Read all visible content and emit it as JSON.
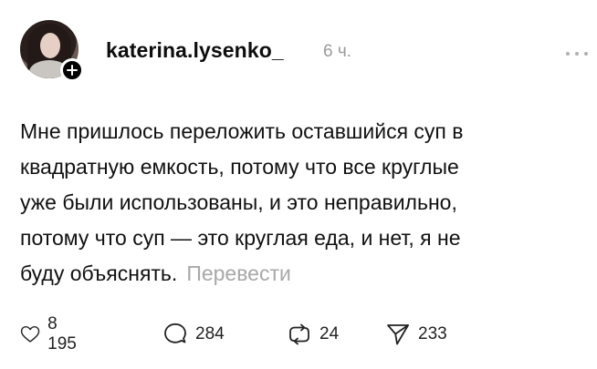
{
  "post": {
    "username": "katerina.lysenko_",
    "time": "6 ч.",
    "text_lines": [
      "Мне пришлось переложить оставшийся суп в",
      "квадратную емкость, потому что все круглые",
      "уже были использованы, и это неправильно,",
      "потому что суп — это круглая еда, и нет, я не",
      "буду объяснять."
    ],
    "translate_label": "Перевести"
  },
  "actions": {
    "likes": "8 195",
    "comments": "284",
    "reposts": "24",
    "shares": "233"
  },
  "icons": [
    "plus-icon",
    "more-icon",
    "heart-icon",
    "comment-icon",
    "repost-icon",
    "share-icon"
  ]
}
